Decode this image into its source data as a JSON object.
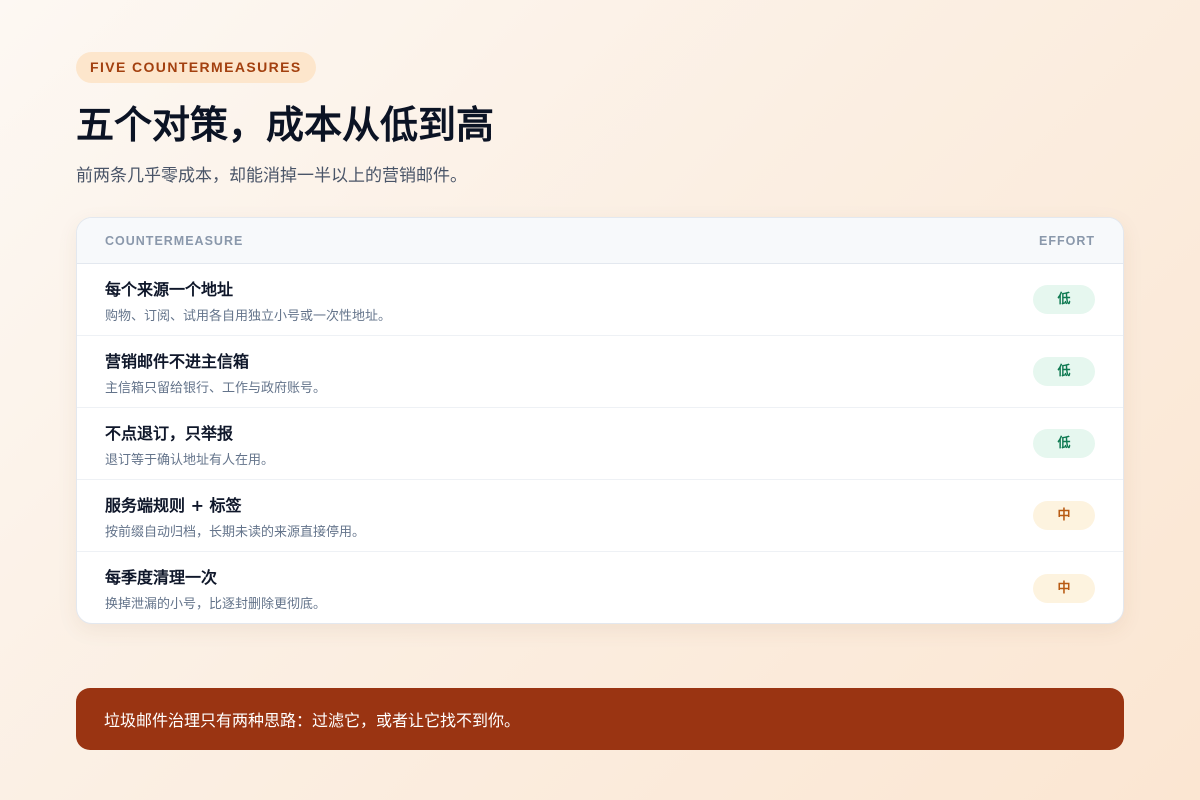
{
  "header": {
    "eyebrow": "FIVE COUNTERMEASURES",
    "title": "五个对策，成本从低到高",
    "subtitle": "前两条几乎零成本，却能消掉一半以上的营销邮件。"
  },
  "table": {
    "columns": {
      "countermeasure": "COUNTERMEASURE",
      "effort": "EFFORT"
    },
    "rows": [
      {
        "name": "每个来源一个地址",
        "desc": "购物、订阅、试用各自用独立小号或一次性地址。",
        "effort": "低",
        "level": "low"
      },
      {
        "name": "营销邮件不进主信箱",
        "desc": "主信箱只留给银行、工作与政府账号。",
        "effort": "低",
        "level": "low"
      },
      {
        "name": "不点退订，只举报",
        "desc": "退订等于确认地址有人在用。",
        "effort": "低",
        "level": "low"
      },
      {
        "name": "服务端规则 + 标签",
        "desc": "按前缀自动归档，长期未读的来源直接停用。",
        "effort": "中",
        "level": "mid"
      },
      {
        "name": "每季度清理一次",
        "desc": "换掉泄漏的小号，比逐封删除更彻底。",
        "effort": "中",
        "level": "mid"
      }
    ]
  },
  "banner": {
    "text": "垃圾邮件治理只有两种思路：过滤它，或者让它找不到你。"
  },
  "colors": {
    "accent": "#9a3412",
    "low_badge_bg": "#e6f7ef",
    "low_badge_text": "#0f7a52",
    "mid_badge_bg": "#fdf3df",
    "mid_badge_text": "#b85a12"
  }
}
